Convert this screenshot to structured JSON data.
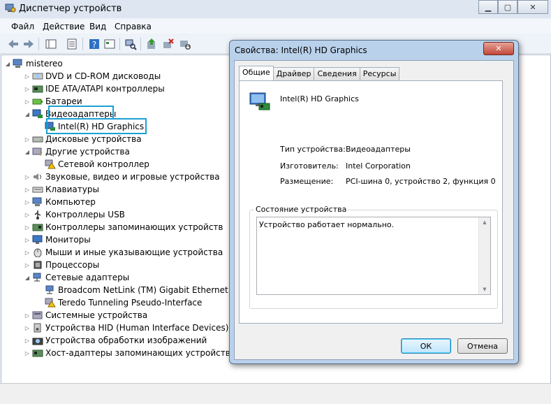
{
  "window": {
    "title": "Диспетчер устройств",
    "menu": [
      "Файл",
      "Действие",
      "Вид",
      "Справка"
    ]
  },
  "tree": {
    "root": "mistereo",
    "items": [
      {
        "label": "DVD и CD-ROM дисководы",
        "icon": "dvd-drive-icon"
      },
      {
        "label": "IDE ATA/ATAPI контроллеры",
        "icon": "ide-controller-icon"
      },
      {
        "label": "Батареи",
        "icon": "battery-icon"
      },
      {
        "label": "Видеоадаптеры",
        "icon": "display-adapter-icon"
      },
      {
        "label": "Intel(R) HD Graphics",
        "icon": "display-adapter-icon"
      },
      {
        "label": "Дисковые устройства",
        "icon": "disk-drive-icon"
      },
      {
        "label": "Другие устройства",
        "icon": "other-devices-icon"
      },
      {
        "label": "Сетевой контроллер",
        "icon": "warning-device-icon"
      },
      {
        "label": "Звуковые, видео и игровые устройства",
        "icon": "sound-icon"
      },
      {
        "label": "Клавиатуры",
        "icon": "keyboard-icon"
      },
      {
        "label": "Компьютер",
        "icon": "computer-icon"
      },
      {
        "label": "Контроллеры USB",
        "icon": "usb-icon"
      },
      {
        "label": "Контроллеры запоминающих устройств",
        "icon": "storage-controller-icon"
      },
      {
        "label": "Мониторы",
        "icon": "monitor-icon"
      },
      {
        "label": "Мыши и иные указывающие устройства",
        "icon": "mouse-icon"
      },
      {
        "label": "Процессоры",
        "icon": "processor-icon"
      },
      {
        "label": "Сетевые адаптеры",
        "icon": "network-adapter-icon"
      },
      {
        "label": "Broadcom NetLink (TM) Gigabit Ethernet",
        "icon": "network-adapter-icon"
      },
      {
        "label": "Teredo Tunneling Pseudo-Interface",
        "icon": "warning-device-icon"
      },
      {
        "label": "Системные устройства",
        "icon": "system-device-icon"
      },
      {
        "label": "Устройства HID (Human Interface Devices)",
        "icon": "hid-icon"
      },
      {
        "label": "Устройства обработки изображений",
        "icon": "camera-icon"
      },
      {
        "label": "Хост-адаптеры запоминающих устройств",
        "icon": "storage-adapter-icon"
      }
    ]
  },
  "dialog": {
    "title": "Свойства: Intel(R) HD Graphics",
    "close": "✕",
    "tabs": [
      "Общие",
      "Драйвер",
      "Сведения",
      "Ресурсы"
    ],
    "device_name": "Intel(R) HD Graphics",
    "props": [
      {
        "key": "Тип устройства:",
        "value": "Видеоадаптеры"
      },
      {
        "key": "Изготовитель:",
        "value": "Intel Corporation"
      },
      {
        "key": "Размещение:",
        "value": "PCI-шина 0, устройство 2, функция 0"
      }
    ],
    "status_title": "Состояние устройства",
    "status_text": "Устройство работает нормально.",
    "ok": "ОК",
    "cancel": "Отмена"
  },
  "colors": {
    "highlight": "#1aa0d4",
    "dialog_frame": "#b9d1ea"
  }
}
